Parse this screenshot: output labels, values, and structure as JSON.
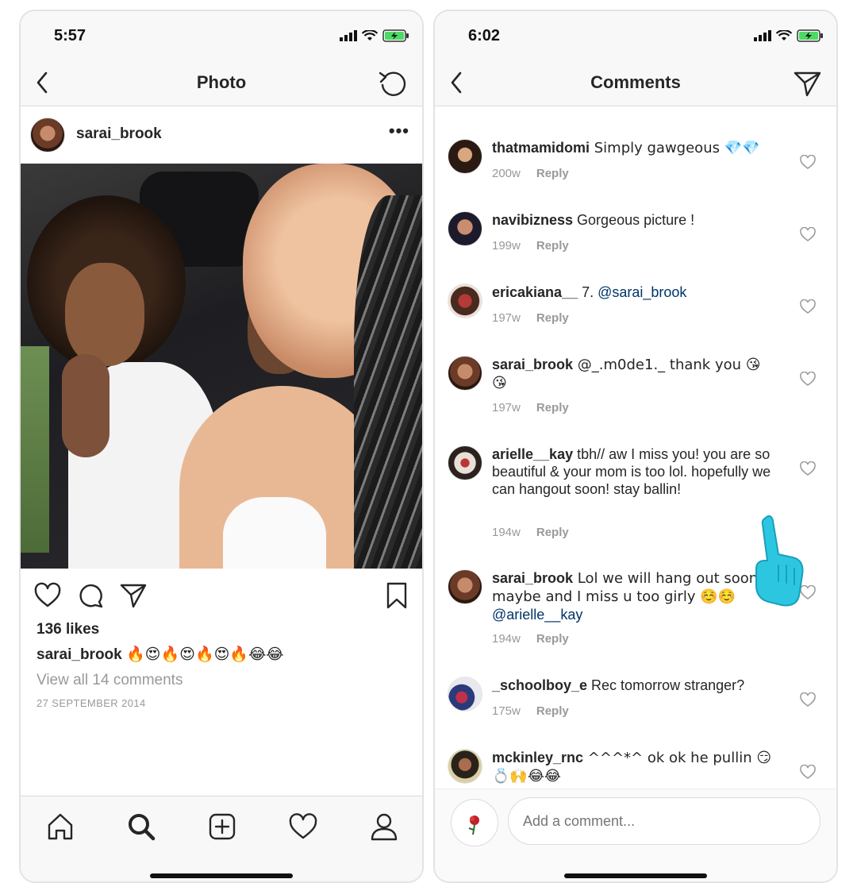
{
  "left": {
    "status": {
      "time": "5:57"
    },
    "nav": {
      "title": "Photo"
    },
    "post": {
      "username": "sarai_brook",
      "more": "•••",
      "likes": "136 likes",
      "caption_user": "sarai_brook",
      "caption_text": "🔥😍🔥😍🔥😍🔥😂😂",
      "view_all": "View all 14 comments",
      "date": "27 SEPTEMBER 2014"
    },
    "tabs": [
      "home-icon",
      "search-icon",
      "new-post-icon",
      "activity-icon",
      "profile-icon"
    ]
  },
  "right": {
    "status": {
      "time": "6:02"
    },
    "nav": {
      "title": "Comments"
    },
    "comments": [
      {
        "user": "thatmamidomi",
        "text": " Simply gawgeous 💎💎",
        "age": "200w",
        "reply": "Reply"
      },
      {
        "user": "navibizness",
        "text": " Gorgeous picture !",
        "age": "199w",
        "reply": "Reply"
      },
      {
        "user": "ericakiana__",
        "text": " 7. ",
        "mention": "@sarai_brook",
        "age": "197w",
        "reply": "Reply"
      },
      {
        "user": "sarai_brook",
        "text": " @_.m0de1._  thank you 😘😘",
        "age": "197w",
        "reply": "Reply"
      },
      {
        "user": "arielle__kay",
        "text": " tbh// aw I miss you! you are so beautiful & your mom is too lol. hopefully we can hangout soon! stay ballin!",
        "age": "194w",
        "reply": "Reply"
      },
      {
        "user": "sarai_brook",
        "text": " Lol we will hang out soon maybe and I miss u too girly ☺️☺️ ",
        "mention": "@arielle__kay",
        "age": "194w",
        "reply": "Reply"
      },
      {
        "user": "_schoolboy_e",
        "text": " Rec tomorrow stranger?",
        "age": "175w",
        "reply": "Reply"
      },
      {
        "user": "mckinley_rnc",
        "text": " ^^^*^ ok ok he pullin 😏💍🙌😂😂"
      }
    ],
    "composer": {
      "placeholder": "Add a comment..."
    }
  },
  "colors": {
    "mention": "#003569",
    "secondary": "#999999",
    "bar": "#f8f8f8",
    "overlay_hand": "#2cc6e0"
  }
}
